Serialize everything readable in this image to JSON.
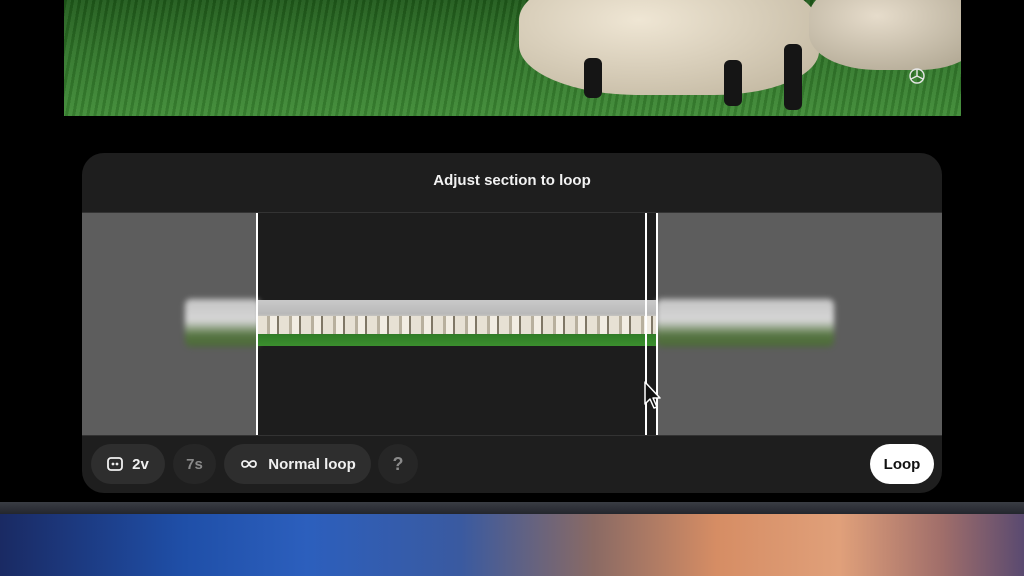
{
  "dialog": {
    "title": "Adjust section to loop"
  },
  "toolbar": {
    "variants_label": "2v",
    "duration_label": "7s",
    "loop_mode_label": "Normal loop",
    "help_label": "?",
    "loop_button_label": "Loop"
  },
  "icons": {
    "video_watermark": "openai-logo-icon",
    "variants": "variants-icon",
    "loop_mode": "infinity-icon",
    "cursor": "mouse-cursor-icon"
  },
  "colors": {
    "panel_bg": "#1e1e1e",
    "pill_bg": "#2e2e2e",
    "handle": "#ffffff",
    "primary_button_bg": "#ffffff"
  }
}
